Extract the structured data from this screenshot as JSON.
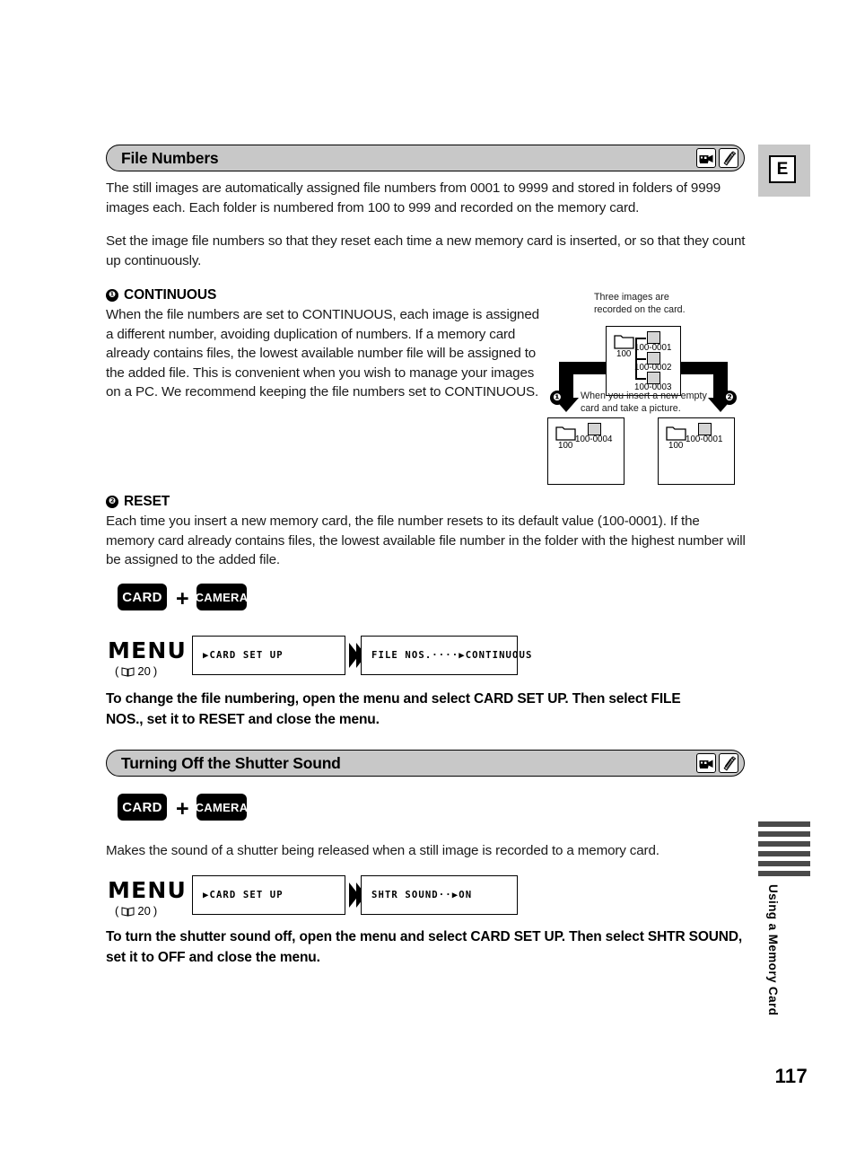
{
  "page": {
    "number": "117",
    "language_tab": "E",
    "side_tab_text": "Using a Memory Card"
  },
  "sections": [
    {
      "id": "file-numbers",
      "heading": "File Numbers",
      "icons": [
        "camcorder-icon",
        "memory-card-icon"
      ],
      "intro": "The still images are automatically assigned file numbers from 0001 to 9999 and stored in folders of 9999 images each. Each folder is numbered from 100 to 999 and recorded on the memory card.",
      "intro2": "Set the image file numbers so that they reset each time a new memory card is inserted, or so that they count up continuously.",
      "items": [
        {
          "marker": "❶",
          "title": "CONTINUOUS",
          "body": "When the file numbers are set to CONTINUOUS, each image is assigned a different number, avoiding duplication of numbers. If a memory card already contains files, the lowest available number file will be assigned to the added file. This is convenient when you wish to manage your images on a PC. We recommend keeping the file numbers set to CONTINUOUS."
        },
        {
          "marker": "❷",
          "title": "RESET",
          "body": "Each time you insert a new memory card, the file number resets to its default value (100-0001). If the memory card already contains files, the lowest available file number in the folder with the highest number will be assigned to the added file."
        }
      ],
      "instruction": "To change the file numbering, open the menu and select CARD SET UP. Then select FILE NOS., set it to RESET and close the menu."
    },
    {
      "id": "shutter-sound",
      "heading": "Turning Off the Shutter Sound",
      "icons": [
        "camcorder-icon",
        "memory-card-icon"
      ],
      "body": "Makes the sound of a shutter being released when a still image is recorded to a memory card.",
      "instruction": "To turn the shutter sound off, open the menu and select CARD SET UP. Then select SHTR SOUND, set it to OFF and close the menu."
    }
  ],
  "mode_row_1": {
    "card_label": "CARD",
    "plus": "+",
    "camera_label": "CAMERA"
  },
  "mode_row_2": {
    "card_label": "CARD",
    "plus": "+",
    "camera_label": "CAMERA"
  },
  "menu_1": {
    "label": "MENU",
    "page_ref_open": "(",
    "page_ref": "20",
    "page_ref_close": ")",
    "box1": "▶CARD SET UP",
    "box2": "FILE NOS.····▶CONTINUOUS"
  },
  "menu_2": {
    "label": "MENU",
    "page_ref_open": "(",
    "page_ref": "20",
    "page_ref_close": ")",
    "box1": "▶CARD SET UP",
    "box2": "SHTR SOUND··▶ON"
  },
  "diagram": {
    "caption_top": "Three images are\nrecorded on the card.",
    "caption_mid": "When you insert a new empty\ncard and take a picture.",
    "card_top": {
      "folder_label": "100",
      "files": [
        "100-0001",
        "100-0002",
        "100-0003"
      ]
    },
    "card_left": {
      "marker": "❶",
      "folder_label": "100",
      "file": "100-0004"
    },
    "card_right": {
      "marker": "❷",
      "folder_label": "100",
      "file": "100-0001"
    }
  },
  "colors": {
    "bar_gray": "#c8c8c8",
    "file_icon_gray": "#d4d4d4",
    "side_tab_gray": "#4a4a4a"
  }
}
